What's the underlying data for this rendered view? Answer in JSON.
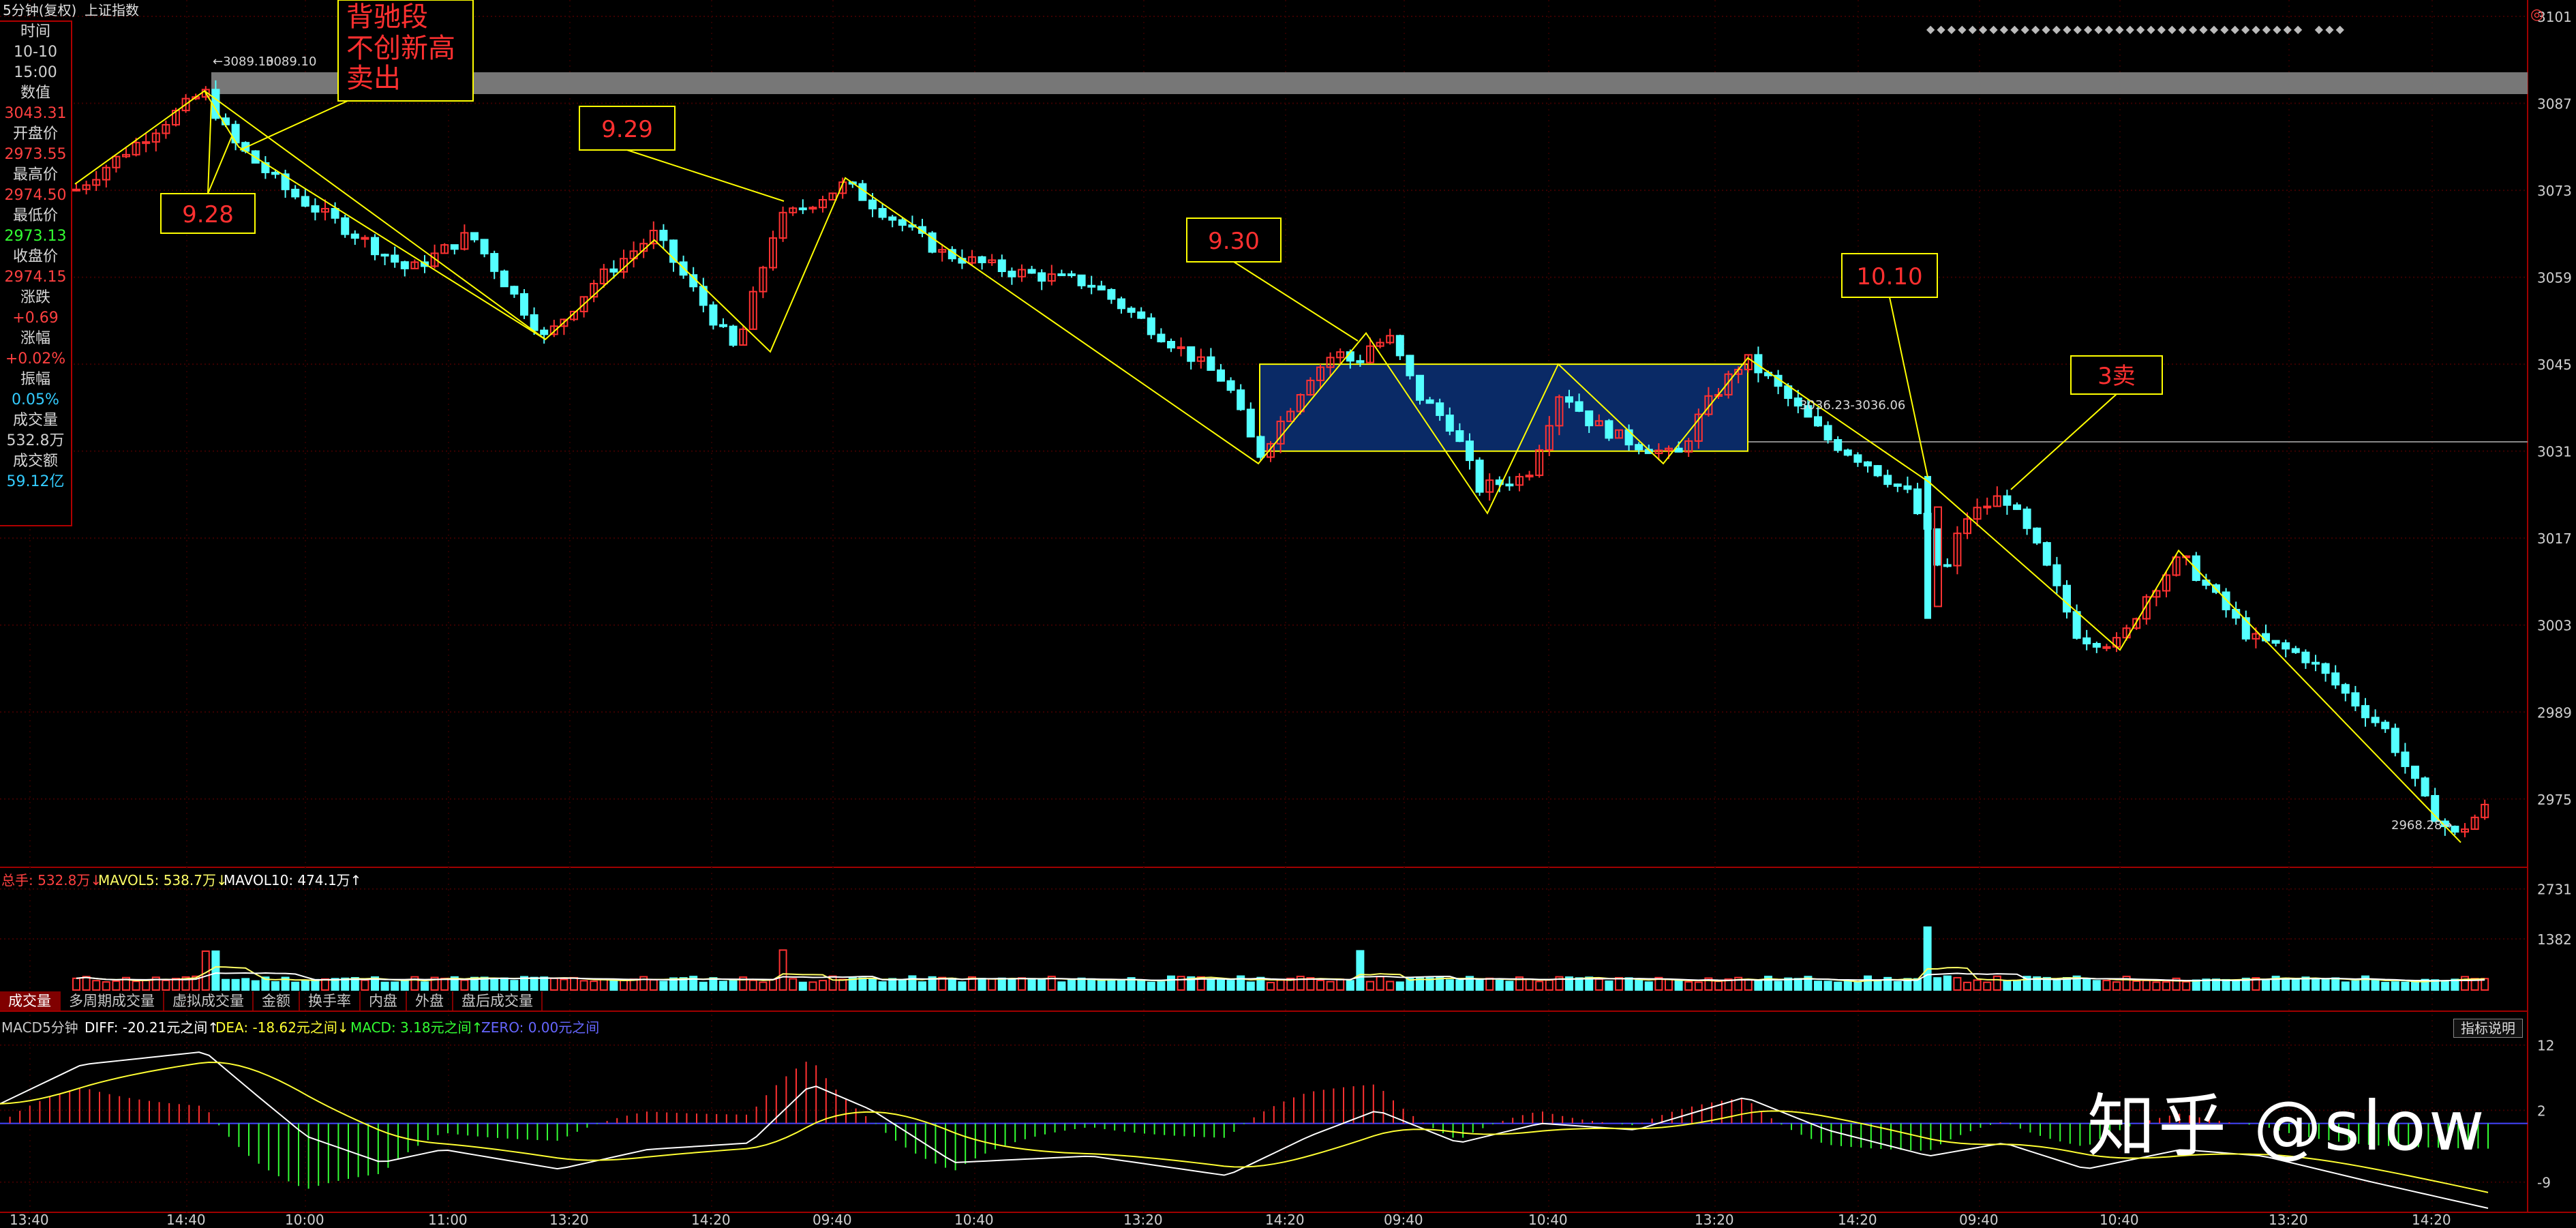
{
  "header": {
    "period": "5分钟(复权)",
    "symbol": "上证指数"
  },
  "info_panel": {
    "rows": [
      {
        "label": "时间",
        "value": "10-10",
        "color": "#d0d0d0"
      },
      {
        "label": "",
        "value": "15:00",
        "color": "#d0d0d0"
      },
      {
        "label": "数值",
        "value": "3043.31",
        "color": "#ff4040"
      },
      {
        "label": "开盘价",
        "value": "2973.55",
        "color": "#ff4040"
      },
      {
        "label": "最高价",
        "value": "2974.50",
        "color": "#ff4040"
      },
      {
        "label": "最低价",
        "value": "2973.13",
        "color": "#33ff33"
      },
      {
        "label": "收盘价",
        "value": "2974.15",
        "color": "#ff4040"
      },
      {
        "label": "涨跌",
        "value": "+0.69",
        "color": "#ff4040"
      },
      {
        "label": "涨幅",
        "value": "+0.02%",
        "color": "#ff4040"
      },
      {
        "label": "振幅",
        "value": "0.05%",
        "color": "#33ccff"
      },
      {
        "label": "成交量",
        "value": "532.8万",
        "color": "#d0d0d0"
      },
      {
        "label": "成交额",
        "value": "59.12亿",
        "color": "#33ccff"
      }
    ]
  },
  "chart_data": [
    {
      "type": "candlestick",
      "title": "上证指数",
      "y_ticks": [
        "3101",
        "3087",
        "3073",
        "3059",
        "3045",
        "3031",
        "3017",
        "3003",
        "2989",
        "2975"
      ],
      "ylim": [
        2964,
        3101
      ],
      "price_labels": [
        "3089.10",
        "3089.10",
        "2968.28",
        "3036.23-3036.06"
      ],
      "annotations": [
        "9.28",
        "9.29",
        "9.30",
        "10.10",
        "3卖",
        "背驰段",
        "不创新高",
        "卖出"
      ],
      "consolidation_range": [
        3031,
        3045
      ],
      "colors": {
        "up": "#ff3232",
        "down": "#54ffff",
        "trend_line": "#ffff00",
        "box_fill": "#0a2a66"
      }
    },
    {
      "type": "bar",
      "title": "成交量",
      "legend": [
        {
          "text": "总手: 532.8万↓",
          "color": "#ff4040"
        },
        {
          "text": "MAVOL5: 538.7万↓",
          "color": "#ffff66"
        },
        {
          "text": "MAVOL10: 474.1万↑",
          "color": "#ffffff"
        }
      ],
      "y_ticks": [
        "2731",
        "1382"
      ],
      "ylim": [
        0,
        2800
      ]
    },
    {
      "type": "line",
      "title": "MACD5分钟",
      "legend": [
        {
          "text": "MACD5分钟",
          "color": "#c8c8c8"
        },
        {
          "text": "DIFF: -20.21元之间↑",
          "color": "#ffffff"
        },
        {
          "text": "DEA: -18.62元之间↓",
          "color": "#ffff33"
        },
        {
          "text": "MACD: 3.18元之间↑",
          "color": "#33ff33"
        },
        {
          "text": "ZERO: 0.00元之间",
          "color": "#6666ff"
        }
      ],
      "y_ticks": [
        "12",
        "2",
        "-9"
      ],
      "ylim": [
        -13,
        15
      ]
    }
  ],
  "time_axis": [
    "13:40",
    "14:40",
    "10:00",
    "11:00",
    "13:20",
    "14:20",
    "09:40",
    "10:40",
    "13:20",
    "14:20",
    "09:40",
    "10:40",
    "13:20",
    "14:20",
    "09:40",
    "10:40",
    "13:20",
    "14:20"
  ],
  "indicator_tabs": [
    {
      "label": "成交量",
      "active": true
    },
    {
      "label": "多周期成交量",
      "active": false
    },
    {
      "label": "虚拟成交量",
      "active": false
    },
    {
      "label": "金额",
      "active": false
    },
    {
      "label": "换手率",
      "active": false
    },
    {
      "label": "内盘",
      "active": false
    },
    {
      "label": "外盘",
      "active": false
    },
    {
      "label": "盘后成交量",
      "active": false
    }
  ],
  "help_button": "指标说明",
  "watermark": "知乎 @slow"
}
